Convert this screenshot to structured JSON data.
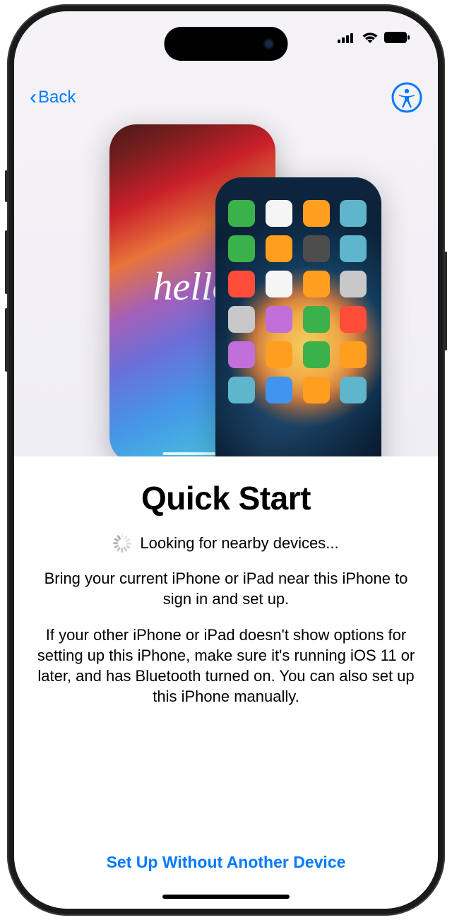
{
  "nav": {
    "back_label": "Back"
  },
  "hero": {
    "hello_word": "hello",
    "app_colors": [
      "#3bb14a",
      "#f5f5f5",
      "#ff9e1f",
      "#5fb5cc",
      "#3bb14a",
      "#ff9e1f",
      "#4d4d4d",
      "#5fb5cc",
      "#ff4d3a",
      "#f5f5f5",
      "#ff9e1f",
      "#c8c8c8",
      "#c8c8c8",
      "#c070d8",
      "#3bb14a",
      "#ff4d3a",
      "#c070d8",
      "#ff9e1f",
      "#3bb14a",
      "#ff9e1f",
      "#5fb5cc",
      "#4095f0",
      "#ff9e1f",
      "#5fb5cc"
    ]
  },
  "content": {
    "title": "Quick Start",
    "status_text": "Looking for nearby devices...",
    "body_1": "Bring your current iPhone or iPad near this iPhone to sign in and set up.",
    "body_2": "If your other iPhone or iPad doesn't show options for setting up this iPhone, make sure it's running iOS 11 or later, and has Bluetooth turned on. You can also set up this iPhone manually.",
    "alt_setup_label": "Set Up Without Another Device"
  },
  "colors": {
    "accent": "#007aff"
  }
}
